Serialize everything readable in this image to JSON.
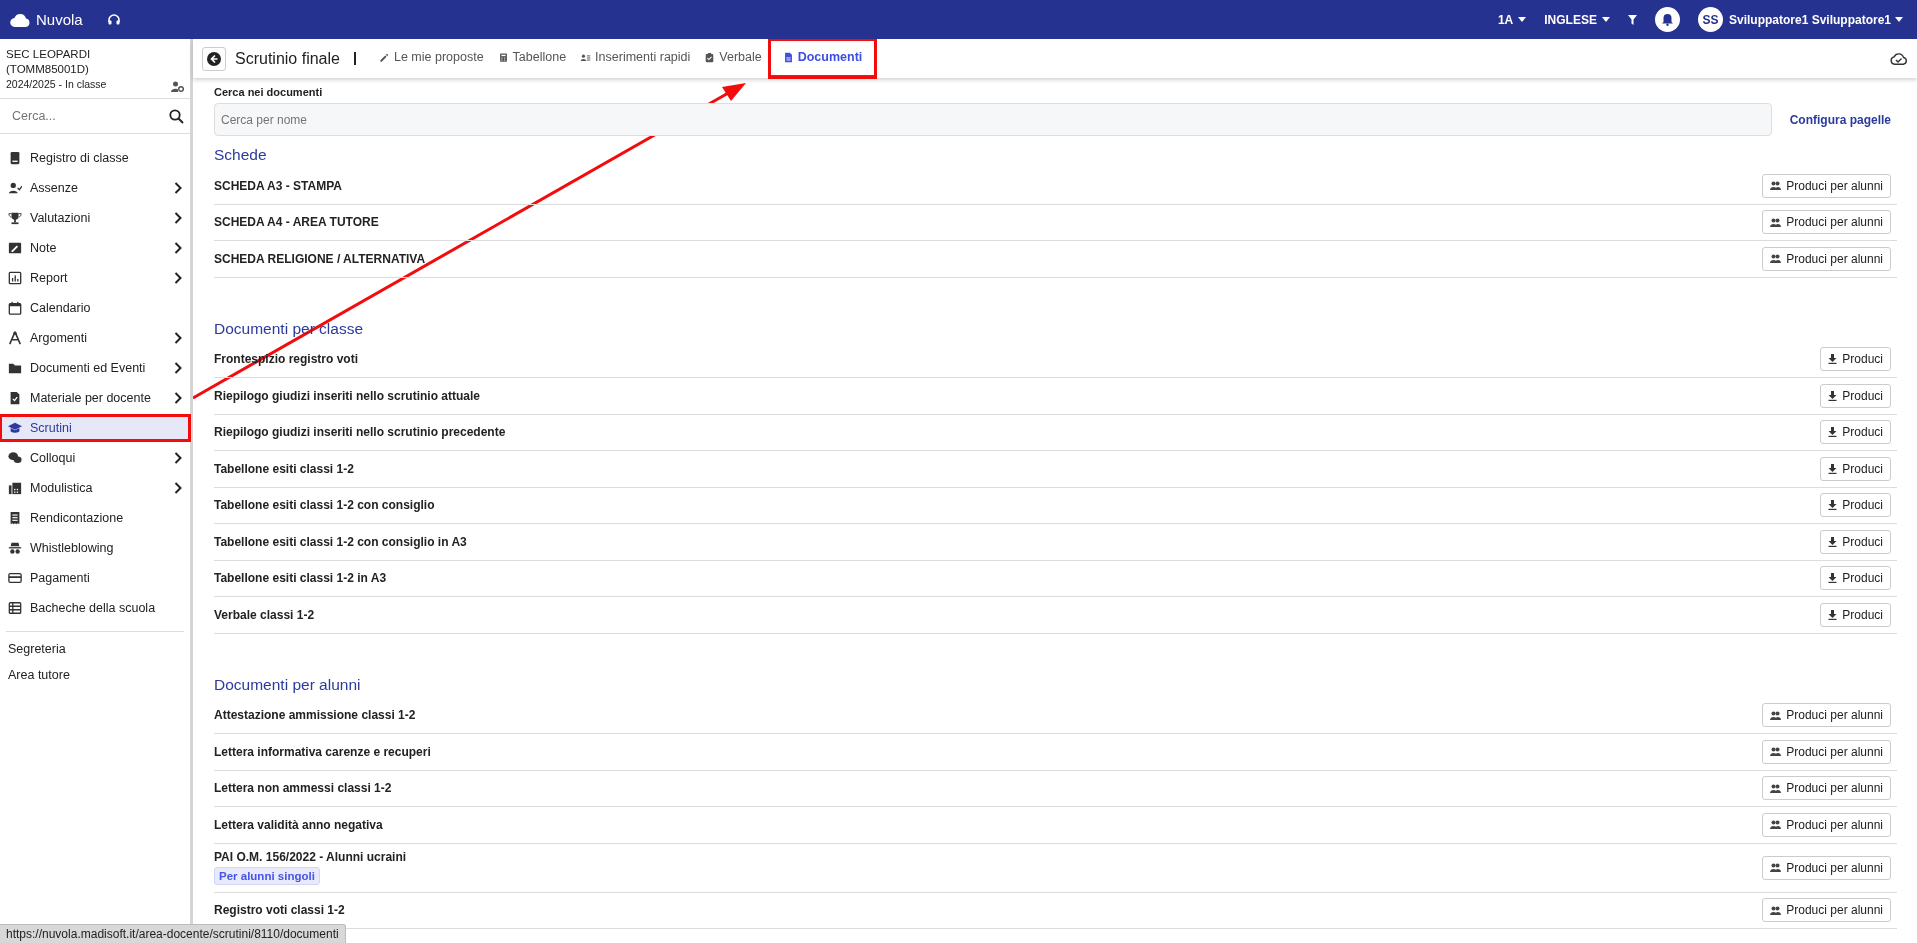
{
  "topbar": {
    "brand": "Nuvola",
    "class_menu": "1A",
    "subject_menu": "INGLESE",
    "avatar_initials": "SS",
    "user_name": "Sviluppatore1 Sviluppatore1"
  },
  "sidebar": {
    "school": "SEC LEOPARDI (TOMM85001D)",
    "year_status": "2024/2025 - In classe",
    "search": {
      "placeholder": "Cerca..."
    },
    "items": [
      {
        "label": "Registro di classe",
        "expandable": false,
        "selected": false,
        "highlighted": false
      },
      {
        "label": "Assenze",
        "expandable": true,
        "selected": false,
        "highlighted": false
      },
      {
        "label": "Valutazioni",
        "expandable": true,
        "selected": false,
        "highlighted": false
      },
      {
        "label": "Note",
        "expandable": true,
        "selected": false,
        "highlighted": false
      },
      {
        "label": "Report",
        "expandable": true,
        "selected": false,
        "highlighted": false
      },
      {
        "label": "Calendario",
        "expandable": false,
        "selected": false,
        "highlighted": false
      },
      {
        "label": "Argomenti",
        "expandable": true,
        "selected": false,
        "highlighted": false
      },
      {
        "label": "Documenti ed Eventi",
        "expandable": true,
        "selected": false,
        "highlighted": false
      },
      {
        "label": "Materiale per docente",
        "expandable": true,
        "selected": false,
        "highlighted": false
      },
      {
        "label": "Scrutini",
        "expandable": false,
        "selected": true,
        "highlighted": true
      },
      {
        "label": "Colloqui",
        "expandable": true,
        "selected": false,
        "highlighted": false
      },
      {
        "label": "Modulistica",
        "expandable": true,
        "selected": false,
        "highlighted": false
      },
      {
        "label": "Rendicontazione",
        "expandable": false,
        "selected": false,
        "highlighted": false
      },
      {
        "label": "Whistleblowing",
        "expandable": false,
        "selected": false,
        "highlighted": false
      },
      {
        "label": "Pagamenti",
        "expandable": false,
        "selected": false,
        "highlighted": false
      },
      {
        "label": "Bacheche della scuola",
        "expandable": false,
        "selected": false,
        "highlighted": false
      }
    ],
    "footer_links": [
      "Segreteria",
      "Area tutore"
    ]
  },
  "header": {
    "title": "Scrutinio finale",
    "tabs": [
      {
        "label": "Le mie proposte",
        "selected": false,
        "highlighted": false
      },
      {
        "label": "Tabellone",
        "selected": false,
        "highlighted": false
      },
      {
        "label": "Inserimenti rapidi",
        "selected": false,
        "highlighted": false
      },
      {
        "label": "Verbale",
        "selected": false,
        "highlighted": false
      },
      {
        "label": "Documenti",
        "selected": true,
        "highlighted": true
      }
    ]
  },
  "search": {
    "label": "Cerca nei documenti",
    "placeholder": "Cerca per nome",
    "link": "Configura pagelle"
  },
  "sections": [
    {
      "title": "Schede",
      "rows": [
        {
          "label": "SCHEDA A3 - STAMPA",
          "button": {
            "kind": "students",
            "label": "Produci per alunni"
          }
        },
        {
          "label": "SCHEDA A4 - AREA TUTORE",
          "button": {
            "kind": "students",
            "label": "Produci per alunni"
          }
        },
        {
          "label": "SCHEDA RELIGIONE / ALTERNATIVA",
          "button": {
            "kind": "students",
            "label": "Produci per alunni"
          }
        }
      ]
    },
    {
      "title": "Documenti per classe",
      "rows": [
        {
          "label": "Frontespizio registro voti",
          "button": {
            "kind": "download",
            "label": "Produci"
          }
        },
        {
          "label": "Riepilogo giudizi inseriti nello scrutinio attuale",
          "button": {
            "kind": "download",
            "label": "Produci"
          }
        },
        {
          "label": "Riepilogo giudizi inseriti nello scrutinio precedente",
          "button": {
            "kind": "download",
            "label": "Produci"
          }
        },
        {
          "label": "Tabellone esiti classi 1-2",
          "button": {
            "kind": "download",
            "label": "Produci"
          }
        },
        {
          "label": "Tabellone esiti classi 1-2 con consiglio",
          "button": {
            "kind": "download",
            "label": "Produci"
          }
        },
        {
          "label": "Tabellone esiti classi 1-2 con consiglio in A3",
          "button": {
            "kind": "download",
            "label": "Produci"
          }
        },
        {
          "label": "Tabellone esiti classi 1-2 in A3",
          "button": {
            "kind": "download",
            "label": "Produci"
          }
        },
        {
          "label": "Verbale classi 1-2",
          "button": {
            "kind": "download",
            "label": "Produci"
          }
        }
      ]
    },
    {
      "title": "Documenti per alunni",
      "rows": [
        {
          "label": "Attestazione ammissione classi 1-2",
          "button": {
            "kind": "students",
            "label": "Produci per alunni"
          }
        },
        {
          "label": "Lettera informativa carenze e recuperi",
          "button": {
            "kind": "students",
            "label": "Produci per alunni"
          }
        },
        {
          "label": "Lettera non ammessi classi 1-2",
          "button": {
            "kind": "students",
            "label": "Produci per alunni"
          }
        },
        {
          "label": "Lettera validità anno negativa",
          "button": {
            "kind": "students",
            "label": "Produci per alunni"
          }
        },
        {
          "label": "PAI O.M. 156/2022 - Alunni ucraini",
          "tag": "Per alunni singoli",
          "button": {
            "kind": "students",
            "label": "Produci per alunni"
          }
        },
        {
          "label": "Registro voti classi 1-2",
          "button": {
            "kind": "students",
            "label": "Produci per alunni"
          }
        }
      ]
    }
  ],
  "annotation_arrow": true,
  "status_url": "https://nuvola.madisoft.it/area-docente/scrutini/8110/documenti"
}
